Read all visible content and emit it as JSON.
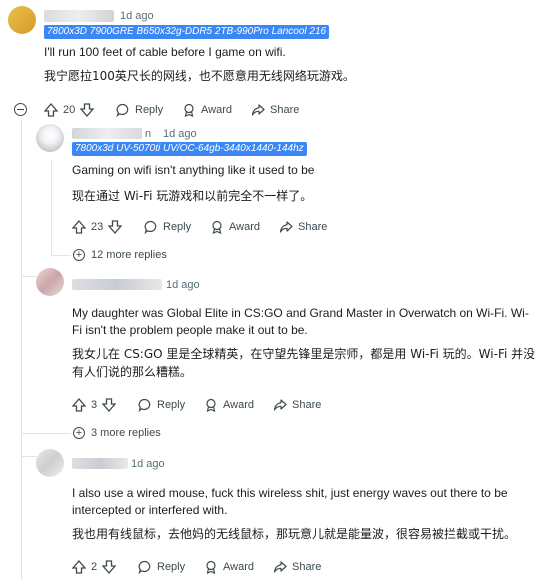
{
  "comments": [
    {
      "time": "1d ago",
      "flair": "7800x3D 7900GRE B650x32g-DDR5 2TB-990Pro Lancool 216",
      "text": "I'll run 100 feet of cable before I game on wifi.",
      "translation": "我宁愿拉100英尺长的网线，也不愿意用无线网络玩游戏。",
      "votes": "20",
      "reply_label": "Reply",
      "award_label": "Award",
      "share_label": "Share"
    },
    {
      "time": "1d ago",
      "author_suffix": "n",
      "flair": "7800x3d UV-5070ti UV/OC-64gb-3440x1440-144hz",
      "text": "Gaming on wifi isn't anything like it used to be",
      "translation": "现在通过 Wi-Fi 玩游戏和以前完全不一样了。",
      "votes": "23",
      "reply_label": "Reply",
      "award_label": "Award",
      "share_label": "Share",
      "more_replies": "12 more replies"
    },
    {
      "time": "1d ago",
      "text_line1": "My daughter was Global Elite in CS:GO and Grand Master in Overwatch on Wi-Fi. Wi-",
      "text_line2": "Fi isn't the problem people make it out to be.",
      "translation_line1": "我女儿在 CS:GO 里是全球精英，在守望先锋里是宗师，都是用 Wi-Fi 玩的。Wi-Fi 并没",
      "translation_line2": "有人们说的那么糟糕。",
      "votes": "3",
      "reply_label": "Reply",
      "award_label": "Award",
      "share_label": "Share",
      "more_replies": "3 more replies"
    },
    {
      "time": "1d ago",
      "text_line1": "I also use a wired mouse, fuck this wireless shit, just energy waves out there to be",
      "text_line2": "intercepted or interfered with.",
      "translation": "我也用有线鼠标，去他妈的无线鼠标，那玩意儿就是能量波，很容易被拦截或干扰。",
      "votes": "2",
      "reply_label": "Reply",
      "award_label": "Award",
      "share_label": "Share"
    }
  ],
  "colors": {
    "flair_bg": "#3b88f5",
    "meta_text": "#576f76",
    "thread_line": "#e2e4e6"
  }
}
